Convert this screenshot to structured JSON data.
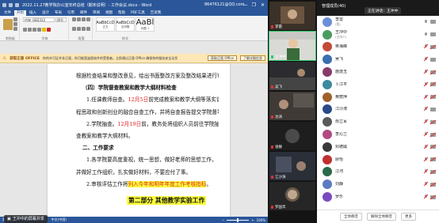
{
  "word": {
    "title": "2022.11.27教学院办公室年终总结（期末说明）- 工作会议.docx - Word",
    "user": "86476121@QQ.com",
    "window_buttons": [
      "—",
      "❐",
      "✕"
    ],
    "tabs": [
      "文件",
      "开始",
      "插入",
      "设计",
      "布局",
      "引用",
      "邮件",
      "审阅",
      "视图",
      "帮助",
      "PDF工具",
      "告诉我"
    ],
    "active_tab": "开始",
    "ribbon": {
      "font_name": "仿宋_GB2312",
      "font_size": "四号",
      "groups": [
        "剪贴板",
        "字体",
        "段落",
        "样式"
      ],
      "styles": [
        {
          "preview": "AaBbCcD",
          "name": "正文"
        },
        {
          "preview": "AaBbCcD",
          "name": "无间隔"
        },
        {
          "preview": "AaBl",
          "name": "标题 1"
        }
      ]
    },
    "banner": {
      "title": "获取正版 OFFICE",
      "text": "你的许可证并非正版，你可能是盗版软件的受害者。立即通过正版 Office 确保你的服务安全无忧",
      "btn1": "获取正版 Office",
      "btn2": "了解详细信息"
    },
    "doc": {
      "lines": [
        {
          "kind": "plain",
          "text": "根据检查结果和整改意见，给出书面整改方案及整改结果进行审核。"
        },
        {
          "kind": "head",
          "text": "（四）学院督查教案和教学大纲材料检查"
        },
        {
          "kind": "mixed",
          "parts": [
            "1.任课教师自查。",
            "12月5日",
            "前完成教案和教学大纲等落实课"
          ]
        },
        {
          "kind": "plain",
          "text": "程思政和创新创业的融合自查工作，并将自查报告提交学院督导。"
        },
        {
          "kind": "mixed",
          "parts": [
            "2.学院抽查。",
            "12月19日",
            "前，教务处将组织人员前往学院抽"
          ]
        },
        {
          "kind": "plain",
          "text": "查教案和教学大纲材料。"
        },
        {
          "kind": "head",
          "text": "二、工作要求"
        },
        {
          "kind": "ind",
          "text": "1.各学院要高度重视，统一思想，做好老师的思想工作，"
        },
        {
          "kind": "plain",
          "text": "并做好工作组织，扎实做好材料，不要应付了事。"
        },
        {
          "kind": "hl",
          "parts": [
            "2.审核评估工作将列入今年和明年年度工作考核指标。"
          ],
          "hl_text": "列入今年和明年年度工作考核指标"
        }
      ],
      "part_heading": "第二部分 其他教学实验工作"
    },
    "status": {
      "page": "第 4 页，共 5 页",
      "words": "2367 个字",
      "lang": "中文(中国)",
      "zoom": "100%"
    },
    "presenter": "王冲中的屏幕共享"
  },
  "gallery": {
    "tiles": [
      {
        "name": "李雷"
      },
      {
        "name": "王冲中",
        "active": true
      },
      {
        "name": "吴飞"
      },
      {
        "name": "沈涛"
      },
      {
        "name": "张静"
      },
      {
        "name": "江沙涛"
      },
      {
        "name": "罗国华"
      }
    ]
  },
  "panel": {
    "title": "管理成员(40)",
    "subtitle": "正在讲话：王冲中",
    "speaking": "正在讲话：王冲中",
    "participants": [
      {
        "name": "李雷",
        "sub": "(我)",
        "color": "#6a8fd8",
        "mic_off": false,
        "cam_off": false
      },
      {
        "name": "王冲中",
        "sub": "(主持人)",
        "color": "#4a9c5e",
        "mic_off": false,
        "cam_off": false
      },
      {
        "name": "蒋海峰",
        "sub": "",
        "color": "#c44a3a",
        "mic_off": true,
        "cam_off": true
      },
      {
        "name": "吴飞",
        "sub": "",
        "color": "#3a6fb0",
        "mic_off": true,
        "cam_off": false
      },
      {
        "name": "施逸玉",
        "sub": "",
        "color": "#8a3a6a",
        "mic_off": true,
        "cam_off": true
      },
      {
        "name": "卜江平",
        "sub": "",
        "color": "#3a8aa0",
        "mic_off": true,
        "cam_off": true
      },
      {
        "name": "黄丽萍",
        "sub": "",
        "color": "#a0602a",
        "mic_off": true,
        "cam_off": true
      },
      {
        "name": "江沙涛",
        "sub": "",
        "color": "#2a4a8a",
        "mic_off": true,
        "cam_off": false
      },
      {
        "name": "俞立军",
        "sub": "",
        "color": "#5a5a5a",
        "mic_off": true,
        "cam_off": true
      },
      {
        "name": "李沁兰",
        "sub": "",
        "color": "#b04a80",
        "mic_off": true,
        "cam_off": true
      },
      {
        "name": "邓德威",
        "sub": "",
        "color": "#3a3a3a",
        "mic_off": true,
        "cam_off": true
      },
      {
        "name": "廖怡",
        "sub": "",
        "color": "#c03030",
        "mic_off": true,
        "cam_off": true
      },
      {
        "name": "江河",
        "sub": "",
        "color": "#2a6a4a",
        "mic_off": true,
        "cam_off": true
      },
      {
        "name": "刘静",
        "sub": "",
        "color": "#5a7ac0",
        "mic_off": true,
        "cam_off": true
      },
      {
        "name": "罗乐",
        "sub": "",
        "color": "#7a4ac0",
        "mic_off": true,
        "cam_off": true
      }
    ],
    "footer": {
      "mute_all": "全体静音",
      "unmute_all": "解除全体静音",
      "more": "更多"
    }
  }
}
